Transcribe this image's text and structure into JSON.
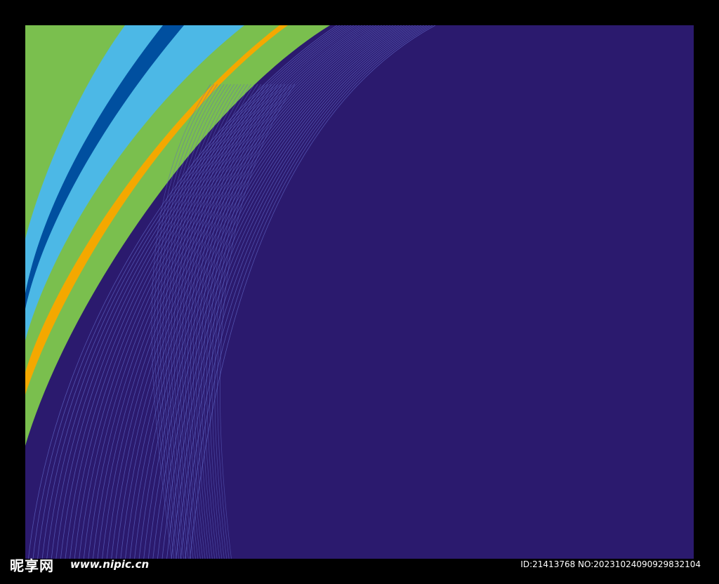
{
  "colors": {
    "frame": "#000000",
    "background": "#2b1a6e",
    "green": "#7abf4e",
    "light_blue": "#4cb8e6",
    "dark_blue": "#004f9f",
    "orange": "#f4a800",
    "fine_lines": "#5f66c4"
  },
  "watermark": {
    "logo_text": "昵享网",
    "url": "www.nipic.cn",
    "id_text": "ID:21413768 NO:20231024090929832104"
  }
}
